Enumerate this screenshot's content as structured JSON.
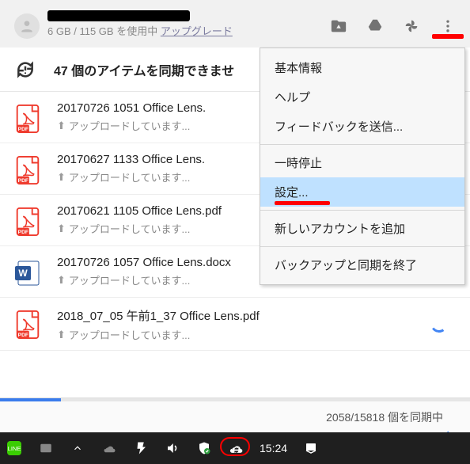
{
  "header": {
    "storage_text": "6 GB / 115 GB を使用中",
    "upgrade_text": "アップグレード"
  },
  "sync": {
    "status": "47 個のアイテムを同期できませ"
  },
  "files": [
    {
      "title": "20170726 1051 Office Lens.",
      "status": "アップロードしています...",
      "type": "pdf",
      "spinner": false
    },
    {
      "title": "20170627 1133 Office Lens.",
      "status": "アップロードしています...",
      "type": "pdf",
      "spinner": false
    },
    {
      "title": "20170621 1105 Office Lens.pdf",
      "status": "アップロードしています...",
      "type": "pdf",
      "spinner": true
    },
    {
      "title": "20170726 1057 Office Lens.docx",
      "status": "アップロードしています...",
      "type": "docx",
      "spinner": true
    },
    {
      "title": "2018_07_05 午前1_37 Office Lens.pdf",
      "status": "アップロードしています...",
      "type": "pdf",
      "spinner": true
    }
  ],
  "footer": {
    "progress_text": "2058/15818 個を同期中"
  },
  "menu": {
    "items": [
      {
        "label": "基本情報"
      },
      {
        "label": "ヘルプ"
      },
      {
        "label": "フィードバックを送信..."
      },
      {
        "label": "一時停止"
      },
      {
        "label": "設定...",
        "selected": true,
        "red": true
      },
      {
        "label": "新しいアカウントを追加"
      },
      {
        "label": "バックアップと同期を終了"
      }
    ],
    "separators_after": [
      2,
      4,
      5
    ]
  },
  "taskbar": {
    "clock": "15:24"
  }
}
